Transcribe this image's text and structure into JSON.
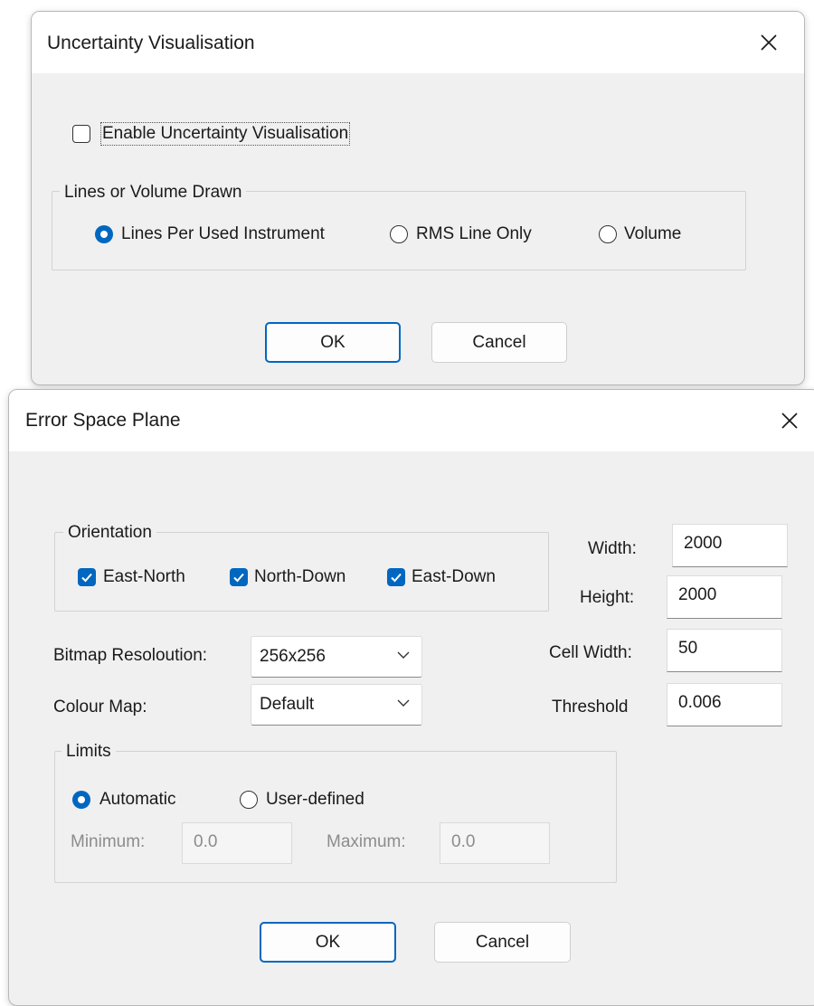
{
  "uncertainty_dialog": {
    "title": "Uncertainty Visualisation",
    "enable_checkbox": {
      "label": "Enable Uncertainty Visualisation",
      "checked": false
    },
    "drawn_group": {
      "title": "Lines or Volume Drawn",
      "options": [
        {
          "label": "Lines Per Used Instrument",
          "selected": true
        },
        {
          "label": "RMS Line Only",
          "selected": false
        },
        {
          "label": "Volume",
          "selected": false
        }
      ]
    },
    "ok_label": "OK",
    "cancel_label": "Cancel"
  },
  "error_space_dialog": {
    "title": "Error Space Plane",
    "orientation": {
      "title": "Orientation",
      "options": [
        {
          "label": "East-North",
          "checked": true
        },
        {
          "label": "North-Down",
          "checked": true
        },
        {
          "label": "East-Down",
          "checked": true
        }
      ]
    },
    "width": {
      "label": "Width:",
      "value": "2000"
    },
    "height": {
      "label": "Height:",
      "value": "2000"
    },
    "cell_width": {
      "label": "Cell Width:",
      "value": "50"
    },
    "threshold": {
      "label": "Threshold",
      "value": "0.006"
    },
    "bitmap_resolution": {
      "label": "Bitmap Resoloution:",
      "value": "256x256"
    },
    "colour_map": {
      "label": "Colour Map:",
      "value": "Default"
    },
    "limits": {
      "title": "Limits",
      "options": [
        {
          "label": "Automatic",
          "selected": true
        },
        {
          "label": "User-defined",
          "selected": false
        }
      ],
      "minimum": {
        "label": "Minimum:",
        "value": "0.0"
      },
      "maximum": {
        "label": "Maximum:",
        "value": "0.0"
      }
    },
    "ok_label": "OK",
    "cancel_label": "Cancel"
  },
  "colors": {
    "accent": "#0067c0",
    "dialog_bg": "#f0f0f0",
    "titlebar_bg": "#ffffff"
  }
}
